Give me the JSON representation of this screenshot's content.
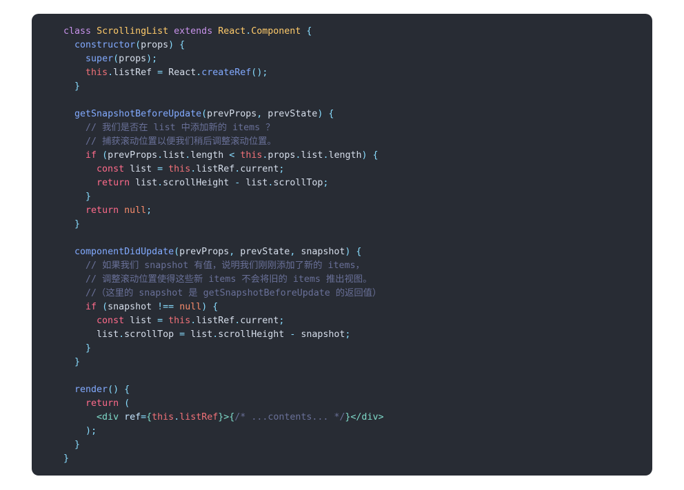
{
  "code_block": {
    "language": "jsx",
    "background_color": "#282c34",
    "lines": [
      [
        {
          "t": "  ",
          "c": "plain"
        },
        {
          "t": "class",
          "c": "kw"
        },
        {
          "t": " ",
          "c": "plain"
        },
        {
          "t": "ScrollingList",
          "c": "type"
        },
        {
          "t": " ",
          "c": "plain"
        },
        {
          "t": "extends",
          "c": "kw"
        },
        {
          "t": " ",
          "c": "plain"
        },
        {
          "t": "React",
          "c": "type"
        },
        {
          "t": ".",
          "c": "punc"
        },
        {
          "t": "Component",
          "c": "type"
        },
        {
          "t": " ",
          "c": "plain"
        },
        {
          "t": "{",
          "c": "punc"
        }
      ],
      [
        {
          "t": "    ",
          "c": "plain"
        },
        {
          "t": "constructor",
          "c": "fn"
        },
        {
          "t": "(",
          "c": "punc"
        },
        {
          "t": "props",
          "c": "plain"
        },
        {
          "t": ")",
          "c": "punc"
        },
        {
          "t": " ",
          "c": "plain"
        },
        {
          "t": "{",
          "c": "punc"
        }
      ],
      [
        {
          "t": "      ",
          "c": "plain"
        },
        {
          "t": "super",
          "c": "fn"
        },
        {
          "t": "(",
          "c": "punc"
        },
        {
          "t": "props",
          "c": "plain"
        },
        {
          "t": ")",
          "c": "punc"
        },
        {
          "t": ";",
          "c": "punc"
        }
      ],
      [
        {
          "t": "      ",
          "c": "plain"
        },
        {
          "t": "this",
          "c": "this"
        },
        {
          "t": ".",
          "c": "punc"
        },
        {
          "t": "listRef",
          "c": "plain"
        },
        {
          "t": " ",
          "c": "plain"
        },
        {
          "t": "=",
          "c": "punc"
        },
        {
          "t": " ",
          "c": "plain"
        },
        {
          "t": "React",
          "c": "plain"
        },
        {
          "t": ".",
          "c": "punc"
        },
        {
          "t": "createRef",
          "c": "fn"
        },
        {
          "t": "(",
          "c": "punc"
        },
        {
          "t": ")",
          "c": "punc"
        },
        {
          "t": ";",
          "c": "punc"
        }
      ],
      [
        {
          "t": "    ",
          "c": "plain"
        },
        {
          "t": "}",
          "c": "punc"
        }
      ],
      [],
      [
        {
          "t": "    ",
          "c": "plain"
        },
        {
          "t": "getSnapshotBeforeUpdate",
          "c": "fn"
        },
        {
          "t": "(",
          "c": "punc"
        },
        {
          "t": "prevProps",
          "c": "plain"
        },
        {
          "t": ",",
          "c": "punc"
        },
        {
          "t": " ",
          "c": "plain"
        },
        {
          "t": "prevState",
          "c": "plain"
        },
        {
          "t": ")",
          "c": "punc"
        },
        {
          "t": " ",
          "c": "plain"
        },
        {
          "t": "{",
          "c": "punc"
        }
      ],
      [
        {
          "t": "      ",
          "c": "plain"
        },
        {
          "t": "// 我们是否在 list 中添加新的 items ？",
          "c": "comment"
        }
      ],
      [
        {
          "t": "      ",
          "c": "plain"
        },
        {
          "t": "// 捕获滚动位置以便我们稍后调整滚动位置。",
          "c": "comment"
        }
      ],
      [
        {
          "t": "      ",
          "c": "plain"
        },
        {
          "t": "if",
          "c": "ctrl"
        },
        {
          "t": " ",
          "c": "plain"
        },
        {
          "t": "(",
          "c": "punc"
        },
        {
          "t": "prevProps",
          "c": "plain"
        },
        {
          "t": ".",
          "c": "punc"
        },
        {
          "t": "list",
          "c": "plain"
        },
        {
          "t": ".",
          "c": "punc"
        },
        {
          "t": "length",
          "c": "plain"
        },
        {
          "t": " ",
          "c": "plain"
        },
        {
          "t": "<",
          "c": "punc"
        },
        {
          "t": " ",
          "c": "plain"
        },
        {
          "t": "this",
          "c": "this"
        },
        {
          "t": ".",
          "c": "punc"
        },
        {
          "t": "props",
          "c": "plain"
        },
        {
          "t": ".",
          "c": "punc"
        },
        {
          "t": "list",
          "c": "plain"
        },
        {
          "t": ".",
          "c": "punc"
        },
        {
          "t": "length",
          "c": "plain"
        },
        {
          "t": ")",
          "c": "punc"
        },
        {
          "t": " ",
          "c": "plain"
        },
        {
          "t": "{",
          "c": "punc"
        }
      ],
      [
        {
          "t": "        ",
          "c": "plain"
        },
        {
          "t": "const",
          "c": "ctrl"
        },
        {
          "t": " ",
          "c": "plain"
        },
        {
          "t": "list",
          "c": "plain"
        },
        {
          "t": " ",
          "c": "plain"
        },
        {
          "t": "=",
          "c": "punc"
        },
        {
          "t": " ",
          "c": "plain"
        },
        {
          "t": "this",
          "c": "this"
        },
        {
          "t": ".",
          "c": "punc"
        },
        {
          "t": "listRef",
          "c": "plain"
        },
        {
          "t": ".",
          "c": "punc"
        },
        {
          "t": "current",
          "c": "plain"
        },
        {
          "t": ";",
          "c": "punc"
        }
      ],
      [
        {
          "t": "        ",
          "c": "plain"
        },
        {
          "t": "return",
          "c": "ctrl"
        },
        {
          "t": " ",
          "c": "plain"
        },
        {
          "t": "list",
          "c": "plain"
        },
        {
          "t": ".",
          "c": "punc"
        },
        {
          "t": "scrollHeight",
          "c": "plain"
        },
        {
          "t": " ",
          "c": "plain"
        },
        {
          "t": "-",
          "c": "punc"
        },
        {
          "t": " ",
          "c": "plain"
        },
        {
          "t": "list",
          "c": "plain"
        },
        {
          "t": ".",
          "c": "punc"
        },
        {
          "t": "scrollTop",
          "c": "plain"
        },
        {
          "t": ";",
          "c": "punc"
        }
      ],
      [
        {
          "t": "      ",
          "c": "plain"
        },
        {
          "t": "}",
          "c": "punc"
        }
      ],
      [
        {
          "t": "      ",
          "c": "plain"
        },
        {
          "t": "return",
          "c": "ctrl"
        },
        {
          "t": " ",
          "c": "plain"
        },
        {
          "t": "null",
          "c": "const"
        },
        {
          "t": ";",
          "c": "punc"
        }
      ],
      [
        {
          "t": "    ",
          "c": "plain"
        },
        {
          "t": "}",
          "c": "punc"
        }
      ],
      [],
      [
        {
          "t": "    ",
          "c": "plain"
        },
        {
          "t": "componentDidUpdate",
          "c": "fn"
        },
        {
          "t": "(",
          "c": "punc"
        },
        {
          "t": "prevProps",
          "c": "plain"
        },
        {
          "t": ",",
          "c": "punc"
        },
        {
          "t": " ",
          "c": "plain"
        },
        {
          "t": "prevState",
          "c": "plain"
        },
        {
          "t": ",",
          "c": "punc"
        },
        {
          "t": " ",
          "c": "plain"
        },
        {
          "t": "snapshot",
          "c": "plain"
        },
        {
          "t": ")",
          "c": "punc"
        },
        {
          "t": " ",
          "c": "plain"
        },
        {
          "t": "{",
          "c": "punc"
        }
      ],
      [
        {
          "t": "      ",
          "c": "plain"
        },
        {
          "t": "// 如果我们 snapshot 有值，说明我们刚刚添加了新的 items，",
          "c": "comment"
        }
      ],
      [
        {
          "t": "      ",
          "c": "plain"
        },
        {
          "t": "// 调整滚动位置使得这些新 items 不会将旧的 items 推出视图。",
          "c": "comment"
        }
      ],
      [
        {
          "t": "      ",
          "c": "plain"
        },
        {
          "t": "//（这里的 snapshot 是 getSnapshotBeforeUpdate 的返回值）",
          "c": "comment"
        }
      ],
      [
        {
          "t": "      ",
          "c": "plain"
        },
        {
          "t": "if",
          "c": "ctrl"
        },
        {
          "t": " ",
          "c": "plain"
        },
        {
          "t": "(",
          "c": "punc"
        },
        {
          "t": "snapshot",
          "c": "plain"
        },
        {
          "t": " ",
          "c": "plain"
        },
        {
          "t": "!==",
          "c": "punc"
        },
        {
          "t": " ",
          "c": "plain"
        },
        {
          "t": "null",
          "c": "const"
        },
        {
          "t": ")",
          "c": "punc"
        },
        {
          "t": " ",
          "c": "plain"
        },
        {
          "t": "{",
          "c": "punc"
        }
      ],
      [
        {
          "t": "        ",
          "c": "plain"
        },
        {
          "t": "const",
          "c": "ctrl"
        },
        {
          "t": " ",
          "c": "plain"
        },
        {
          "t": "list",
          "c": "plain"
        },
        {
          "t": " ",
          "c": "plain"
        },
        {
          "t": "=",
          "c": "punc"
        },
        {
          "t": " ",
          "c": "plain"
        },
        {
          "t": "this",
          "c": "this"
        },
        {
          "t": ".",
          "c": "punc"
        },
        {
          "t": "listRef",
          "c": "plain"
        },
        {
          "t": ".",
          "c": "punc"
        },
        {
          "t": "current",
          "c": "plain"
        },
        {
          "t": ";",
          "c": "punc"
        }
      ],
      [
        {
          "t": "        ",
          "c": "plain"
        },
        {
          "t": "list",
          "c": "plain"
        },
        {
          "t": ".",
          "c": "punc"
        },
        {
          "t": "scrollTop",
          "c": "plain"
        },
        {
          "t": " ",
          "c": "plain"
        },
        {
          "t": "=",
          "c": "punc"
        },
        {
          "t": " ",
          "c": "plain"
        },
        {
          "t": "list",
          "c": "plain"
        },
        {
          "t": ".",
          "c": "punc"
        },
        {
          "t": "scrollHeight",
          "c": "plain"
        },
        {
          "t": " ",
          "c": "plain"
        },
        {
          "t": "-",
          "c": "punc"
        },
        {
          "t": " ",
          "c": "plain"
        },
        {
          "t": "snapshot",
          "c": "plain"
        },
        {
          "t": ";",
          "c": "punc"
        }
      ],
      [
        {
          "t": "      ",
          "c": "plain"
        },
        {
          "t": "}",
          "c": "punc"
        }
      ],
      [
        {
          "t": "    ",
          "c": "plain"
        },
        {
          "t": "}",
          "c": "punc"
        }
      ],
      [],
      [
        {
          "t": "    ",
          "c": "plain"
        },
        {
          "t": "render",
          "c": "fn"
        },
        {
          "t": "(",
          "c": "punc"
        },
        {
          "t": ")",
          "c": "punc"
        },
        {
          "t": " ",
          "c": "plain"
        },
        {
          "t": "{",
          "c": "punc"
        }
      ],
      [
        {
          "t": "      ",
          "c": "plain"
        },
        {
          "t": "return",
          "c": "ctrl"
        },
        {
          "t": " ",
          "c": "plain"
        },
        {
          "t": "(",
          "c": "punc"
        }
      ],
      [
        {
          "t": "        ",
          "c": "plain"
        },
        {
          "t": "<div",
          "c": "tag"
        },
        {
          "t": " ",
          "c": "plain"
        },
        {
          "t": "ref",
          "c": "attr"
        },
        {
          "t": "=",
          "c": "punc"
        },
        {
          "t": "{",
          "c": "tag"
        },
        {
          "t": "this",
          "c": "jsxexpr"
        },
        {
          "t": ".",
          "c": "punc"
        },
        {
          "t": "listRef",
          "c": "jsxexpr"
        },
        {
          "t": "}",
          "c": "tag"
        },
        {
          "t": ">",
          "c": "tag"
        },
        {
          "t": "{",
          "c": "tag"
        },
        {
          "t": "/* ...contents... */",
          "c": "comment"
        },
        {
          "t": "}",
          "c": "tag"
        },
        {
          "t": "</div>",
          "c": "tag"
        }
      ],
      [
        {
          "t": "      ",
          "c": "plain"
        },
        {
          "t": ")",
          "c": "punc"
        },
        {
          "t": ";",
          "c": "punc"
        }
      ],
      [
        {
          "t": "    ",
          "c": "plain"
        },
        {
          "t": "}",
          "c": "punc"
        }
      ],
      [
        {
          "t": "  ",
          "c": "plain"
        },
        {
          "t": "}",
          "c": "punc"
        }
      ]
    ]
  }
}
